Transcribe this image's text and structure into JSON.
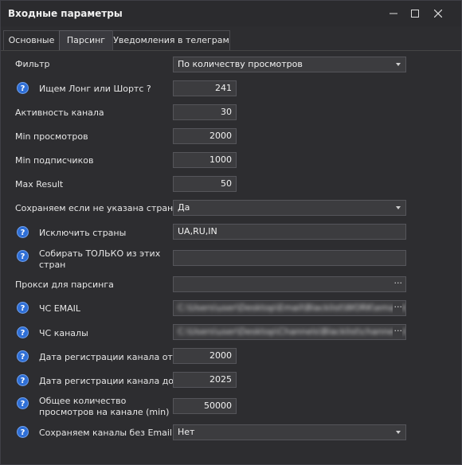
{
  "window": {
    "title": "Входные параметры",
    "minimize_icon": "minimize-icon",
    "maximize_icon": "maximize-icon",
    "close_icon": "close-icon"
  },
  "tabs": [
    {
      "label": "Основные",
      "active": false
    },
    {
      "label": "Парсинг",
      "active": true
    },
    {
      "label": "Уведомления в телеграм",
      "active": false
    }
  ],
  "fields": {
    "filter": {
      "label": "Фильтр",
      "value": "По количеству просмотров"
    },
    "long_shorts": {
      "label": "Ищем Лонг или Шортс ?",
      "value": "241"
    },
    "channel_activity": {
      "label": "Активность канала",
      "value": "30"
    },
    "min_views": {
      "label": "Min просмотров",
      "value": "2000"
    },
    "min_subs": {
      "label": "Min подписчиков",
      "value": "1000"
    },
    "max_result": {
      "label": "Max Result",
      "value": "50"
    },
    "save_no_country": {
      "label": "Сохраняем если не указана страна?",
      "value": "Да"
    },
    "exclude_countries": {
      "label": "Исключить страны",
      "value": "UA,RU,IN"
    },
    "only_countries": {
      "label": "Собирать ТОЛЬКО из этих стран",
      "value": ""
    },
    "proxy": {
      "label": "Прокси для парсинга",
      "value": ""
    },
    "bl_email": {
      "label": "ЧС EMAIL",
      "value": "C:\\Users\\user\\Desktop\\Email\\Blacklist\\WORK\\email.txt"
    },
    "bl_channels": {
      "label": "ЧС каналы",
      "value": "C:\\Users\\user\\Desktop\\Channels\\Blacklist\\channels.txt"
    },
    "reg_from": {
      "label": "Дата регистрации канала от",
      "value": "2000"
    },
    "reg_to": {
      "label": "Дата регистрации канала до",
      "value": "2025"
    },
    "total_views": {
      "label": "Общее количество просмотров на канале (min)",
      "value": "50000"
    },
    "save_no_email": {
      "label": "Сохраняем каналы без Email ?",
      "value": "Нет"
    }
  },
  "browse_label": "···",
  "help_glyph": "?",
  "colors": {
    "background": "#2d2d30",
    "field": "#3c3c3f",
    "help_icon": "#2f6fd6"
  }
}
